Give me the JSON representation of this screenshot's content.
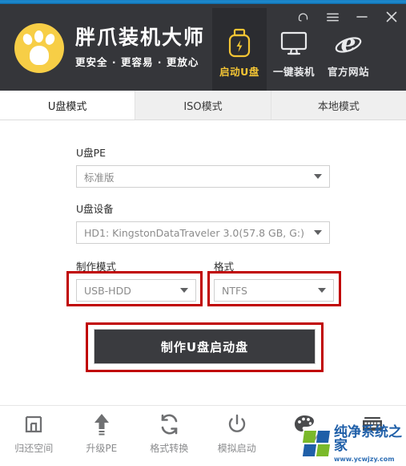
{
  "window": {
    "controls": [
      {
        "name": "support-headset-icon",
        "label": ""
      },
      {
        "name": "menu-icon",
        "label": ""
      },
      {
        "name": "minimize-icon",
        "label": ""
      },
      {
        "name": "close-icon",
        "label": ""
      }
    ]
  },
  "header": {
    "title": "胖爪装机大师",
    "subtitle_parts": [
      "更安全",
      "更容易",
      "更放心"
    ],
    "subtitle": "更安全 · 更容易 · 更放心",
    "logo_icon": "paw-logo-icon",
    "accent_color": "#f4c534",
    "background_color": "#35363a"
  },
  "nav": {
    "items": [
      {
        "label": "启动U盘",
        "icon": "usb-drive-icon",
        "active": true
      },
      {
        "label": "一键装机",
        "icon": "monitor-icon",
        "active": false
      },
      {
        "label": "官方网站",
        "icon": "internet-explorer-icon",
        "active": false
      }
    ]
  },
  "tabs": [
    {
      "label": "U盘模式",
      "active": true
    },
    {
      "label": "ISO模式",
      "active": false
    },
    {
      "label": "本地模式",
      "active": false
    }
  ],
  "form": {
    "pe": {
      "label": "U盘PE",
      "value": "标准版"
    },
    "device": {
      "label": "U盘设备",
      "value": "HD1: KingstonDataTraveler 3.0(57.8 GB, G:)"
    },
    "mode": {
      "label": "制作模式",
      "value": "USB-HDD"
    },
    "filesystem": {
      "label": "格式",
      "value": "NTFS"
    },
    "make_button": "制作U盘启动盘"
  },
  "highlight": {
    "color": "#c00000",
    "boxes": [
      "mode-select",
      "filesystem-select",
      "make-button"
    ]
  },
  "toolbar": {
    "items": [
      {
        "label": "归还空间",
        "icon": "restore-space-icon"
      },
      {
        "label": "升级PE",
        "icon": "upgrade-arrow-icon"
      },
      {
        "label": "格式转换",
        "icon": "format-convert-icon"
      },
      {
        "label": "模拟启动",
        "icon": "power-simulate-icon"
      },
      {
        "label": "",
        "icon": "palette-icon"
      },
      {
        "label": "",
        "icon": "keyboard-icon"
      }
    ]
  },
  "watermark": {
    "title": "纯净系统之家",
    "url": "www.ycwjzy.com",
    "colors": {
      "blue": "#1f5fa8",
      "green": "#7ab929"
    }
  }
}
